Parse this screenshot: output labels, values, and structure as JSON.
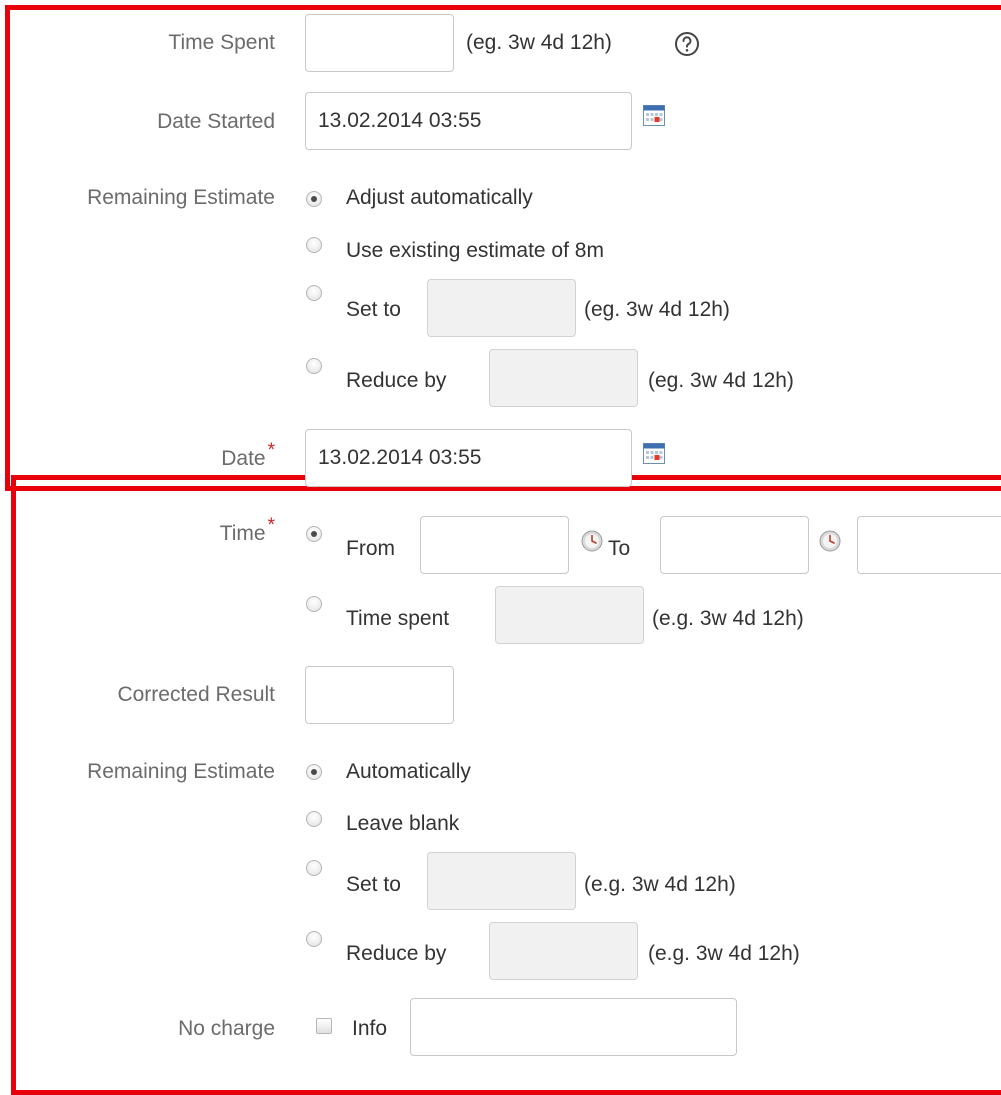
{
  "section_issue_fields": {
    "time_spent": {
      "label": "Time Spent",
      "value": "",
      "hint": "(eg. 3w 4d 12h)"
    },
    "date_started": {
      "label": "Date Started",
      "value": "13.02.2014 03:55"
    },
    "remaining_estimate": {
      "label": "Remaining Estimate",
      "options": {
        "adjust": "Adjust automatically",
        "existing": "Use existing estimate of 8m",
        "set_to": "Set to",
        "reduce_by": "Reduce by"
      },
      "selected": "adjust",
      "set_to_hint": "(eg. 3w 4d 12h)",
      "reduce_by_hint": "(eg. 3w 4d 12h)"
    },
    "date": {
      "label": "Date",
      "required_mark": "*",
      "value": "13.02.2014 03:55"
    }
  },
  "section_worklog_fields": {
    "time": {
      "label": "Time",
      "required_mark": "*",
      "from_label": "From",
      "to_label": "To",
      "time_spent_label": "Time spent",
      "time_spent_hint": "(e.g. 3w 4d 12h)",
      "selected": "from_to"
    },
    "corrected_result": {
      "label": "Corrected Result",
      "value": ""
    },
    "remaining_estimate": {
      "label": "Remaining Estimate",
      "options": {
        "automatically": "Automatically",
        "leave_blank": "Leave blank",
        "set_to": "Set to",
        "reduce_by": "Reduce by"
      },
      "selected": "automatically",
      "set_to_hint": "(e.g. 3w 4d 12h)",
      "reduce_by_hint": "(e.g. 3w 4d 12h)"
    },
    "no_charge": {
      "label": "No charge",
      "checked": false,
      "info_label": "Info",
      "info_value": ""
    }
  },
  "colors": {
    "highlight_border": "#e8000b",
    "label": "#6b6b6b",
    "required": "#cc2222"
  },
  "icons": [
    "help-icon",
    "calendar-icon",
    "clock-icon"
  ]
}
